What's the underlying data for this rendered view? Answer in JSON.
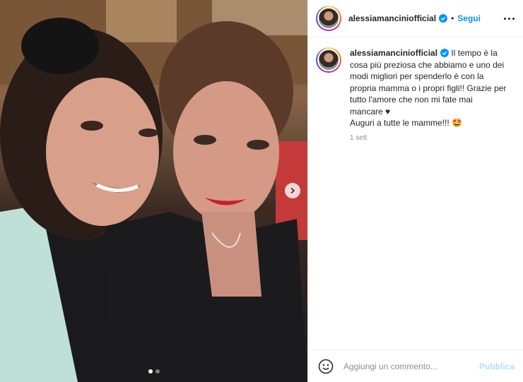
{
  "post": {
    "photo_alt": "",
    "carousel": {
      "slide_count": 2,
      "active_slide": 1
    }
  },
  "header": {
    "username": "alessiamanciniofficial",
    "separator": "•",
    "follow_label": "Segui"
  },
  "caption": {
    "username": "alessiamanciniofficial",
    "text": " Il tempo è la cosa più preziosa che abbiamo e uno dei modi migliori per spenderlo è con la propria mamma o i propri figli!! Grazie per tutto l'amore che non mi fate mai mancare ♥",
    "text2": "Auguri a tutte le mamme!!! 🤩",
    "time": "1 sett"
  },
  "composer": {
    "placeholder": "Aggiungi un commento...",
    "publish_label": "Pubblica"
  },
  "colors": {
    "link_blue": "#0095f6",
    "publish_disabled": "#b2dffc",
    "verified": "#0095f6"
  }
}
